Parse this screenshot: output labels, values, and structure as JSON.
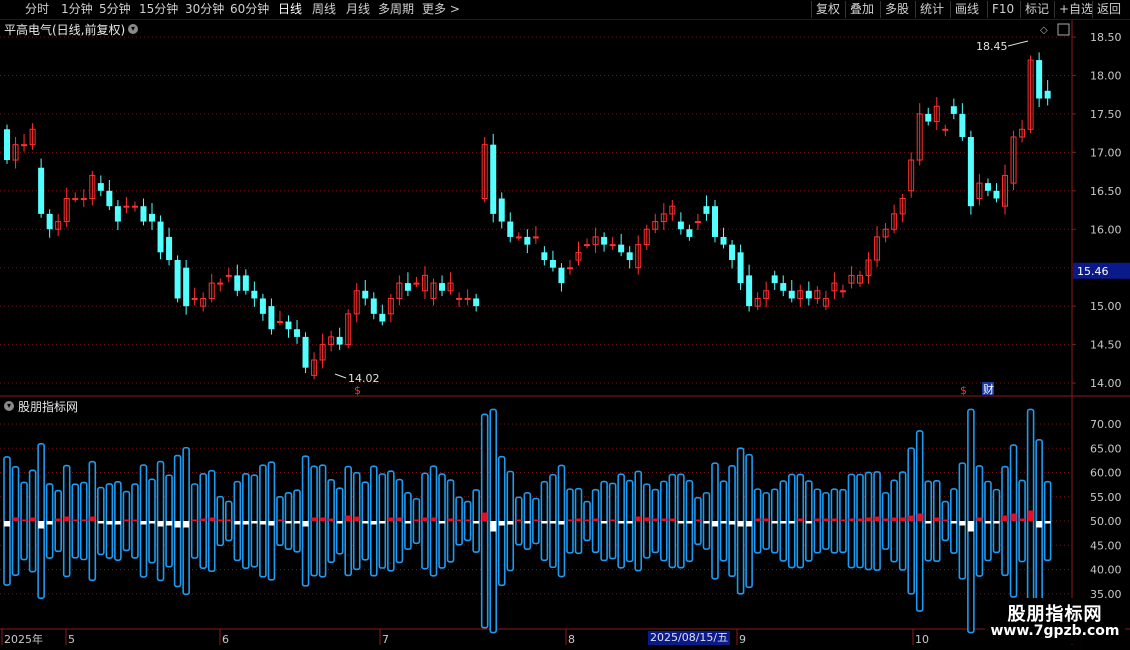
{
  "toolbar": {
    "left": [
      "分时",
      "1分钟",
      "5分钟",
      "15分钟",
      "30分钟",
      "60分钟",
      "日线",
      "周线",
      "月线",
      "多周期",
      "更多 >"
    ],
    "active": "日线",
    "right": [
      "复权",
      "叠加",
      "多股",
      "统计",
      "画线",
      "F10",
      "标记",
      "+自选",
      "返回"
    ]
  },
  "stock_title": "平高电气(日线,前复权)",
  "sub_title": "股朋指标网",
  "price_axis": {
    "labels": [
      "18.50",
      "18.00",
      "17.50",
      "17.00",
      "16.50",
      "16.00",
      "15.50",
      "15.00",
      "14.50",
      "14.00"
    ],
    "current_price": "15.46",
    "current_price_color": "#0a1a8a"
  },
  "indicator_axis": {
    "labels": [
      "70.00",
      "65.00",
      "60.00",
      "55.00",
      "50.00",
      "45.00",
      "40.00",
      "35.00"
    ]
  },
  "annotations": {
    "high": "18.45",
    "low": "14.02",
    "dollar_marks": [
      "$",
      "$"
    ],
    "finance_mark": "财"
  },
  "date_axis": {
    "labels": [
      "2025年",
      "5",
      "6",
      "7",
      "8",
      "9",
      "10"
    ],
    "cursor_date": "2025/08/15/五"
  },
  "watermark": {
    "name": "股朋指标网",
    "url": "www.7gpzb.com"
  },
  "colors": {
    "up": "#ff3030",
    "down": "#54ffff",
    "grid": "#7a1010",
    "axis_text": "#c8c8c8",
    "bar_blue": "#1e9af0",
    "bar_red": "#e0102a"
  },
  "chart_data": {
    "type": "candlestick",
    "open": [
      17.3,
      16.9,
      17.1,
      17.1,
      16.8,
      16.2,
      16.0,
      16.1,
      16.4,
      16.4,
      16.4,
      16.6,
      16.5,
      16.3,
      16.3,
      16.3,
      16.3,
      16.2,
      16.1,
      15.9,
      15.6,
      15.5,
      15.1,
      15.0,
      15.1,
      15.3,
      15.4,
      15.4,
      15.4,
      15.2,
      15.1,
      15.0,
      14.8,
      14.8,
      14.7,
      14.6,
      14.1,
      14.3,
      14.5,
      14.6,
      14.5,
      14.9,
      15.2,
      15.1,
      14.9,
      14.9,
      15.1,
      15.3,
      15.3,
      15.2,
      15.1,
      15.3,
      15.2,
      15.1,
      15.1,
      15.1,
      16.4,
      17.1,
      16.4,
      16.1,
      15.9,
      15.9,
      15.9,
      15.7,
      15.6,
      15.5,
      15.5,
      15.6,
      15.8,
      15.8,
      15.9,
      15.8,
      15.8,
      15.7,
      15.5,
      15.8,
      16.0,
      16.1,
      16.2,
      16.1,
      16.0,
      16.1,
      16.3,
      16.3,
      15.9,
      15.8,
      15.7,
      15.4,
      15.0,
      15.1,
      15.4,
      15.3,
      15.2,
      15.1,
      15.2,
      15.1,
      15.0,
      15.2,
      15.2,
      15.3,
      15.3,
      15.4,
      15.6,
      15.9,
      16.0,
      16.2,
      16.5,
      16.9,
      17.5,
      17.4,
      17.3,
      17.6,
      17.5,
      17.2,
      16.4,
      16.6,
      16.5,
      16.3,
      16.6,
      17.2,
      17.3,
      18.2,
      17.8
    ],
    "close": [
      16.9,
      17.1,
      17.1,
      17.3,
      16.2,
      16.0,
      16.1,
      16.4,
      16.4,
      16.4,
      16.7,
      16.5,
      16.3,
      16.1,
      16.3,
      16.3,
      16.1,
      16.1,
      15.7,
      15.6,
      15.1,
      15.0,
      15.1,
      15.1,
      15.3,
      15.3,
      15.4,
      15.2,
      15.2,
      15.1,
      14.9,
      14.7,
      14.8,
      14.7,
      14.6,
      14.2,
      14.3,
      14.5,
      14.6,
      14.5,
      14.9,
      15.2,
      15.1,
      14.9,
      14.8,
      15.1,
      15.3,
      15.2,
      15.3,
      15.4,
      15.3,
      15.2,
      15.3,
      15.1,
      15.1,
      15.0,
      17.1,
      16.2,
      16.1,
      15.9,
      15.9,
      15.8,
      15.9,
      15.6,
      15.5,
      15.3,
      15.5,
      15.7,
      15.8,
      15.9,
      15.8,
      15.8,
      15.7,
      15.6,
      15.8,
      16.0,
      16.1,
      16.2,
      16.3,
      16.0,
      15.9,
      16.1,
      16.2,
      15.9,
      15.8,
      15.6,
      15.3,
      15.0,
      15.1,
      15.2,
      15.3,
      15.2,
      15.1,
      15.2,
      15.1,
      15.2,
      15.1,
      15.3,
      15.2,
      15.4,
      15.4,
      15.6,
      15.9,
      16.0,
      16.2,
      16.4,
      16.9,
      17.5,
      17.4,
      17.6,
      17.3,
      17.5,
      17.2,
      16.3,
      16.6,
      16.5,
      16.4,
      16.7,
      17.2,
      17.3,
      18.2,
      17.7,
      17.7
    ]
  }
}
